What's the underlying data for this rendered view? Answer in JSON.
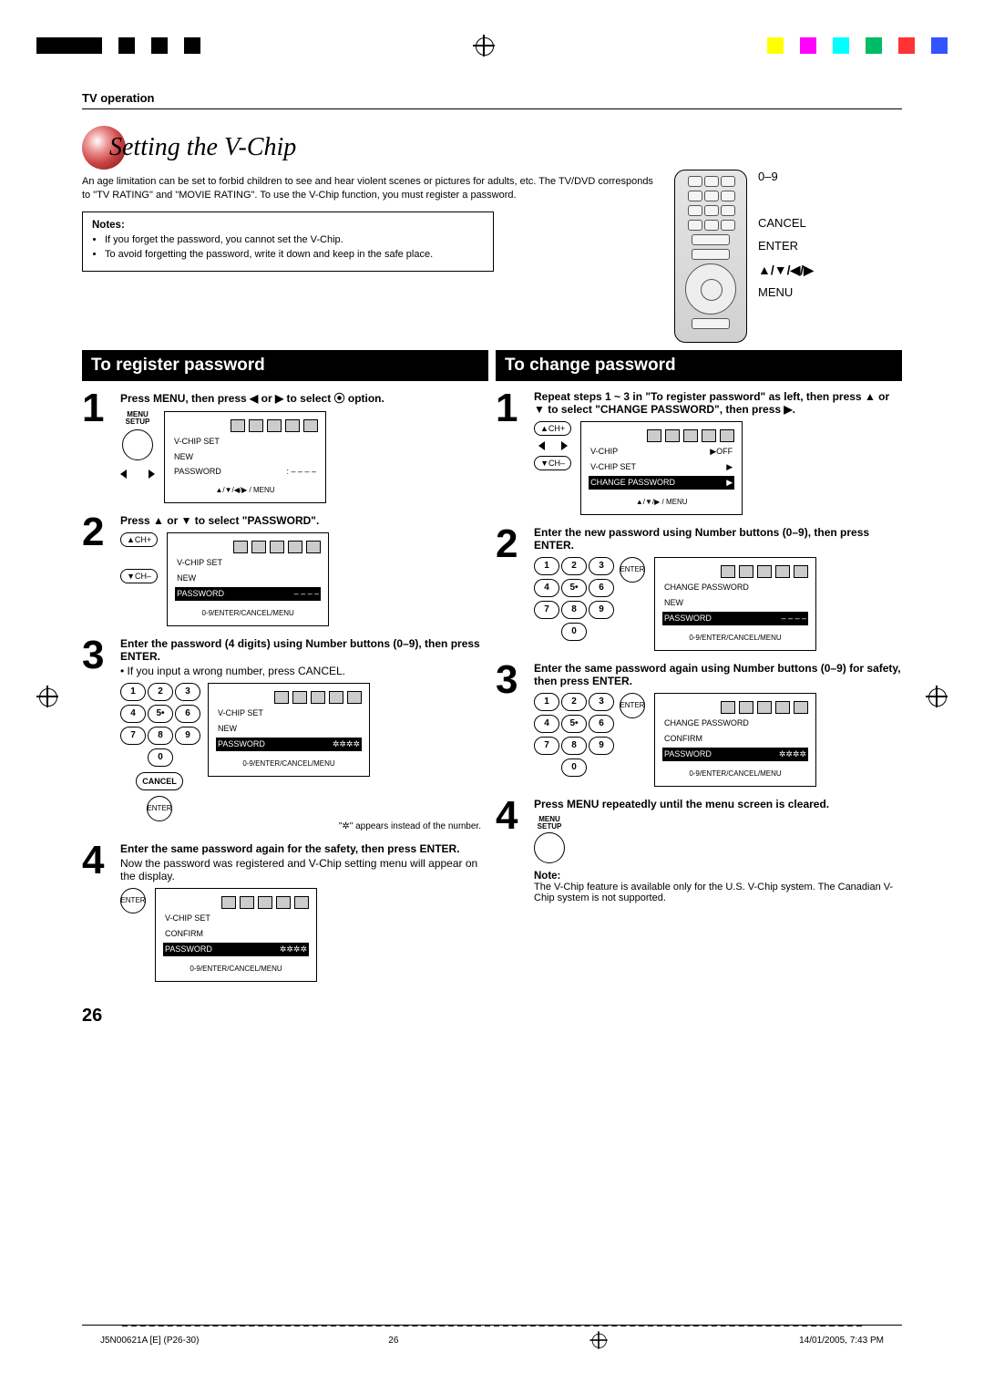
{
  "header": {
    "section": "TV operation",
    "title": "Setting the V-Chip",
    "intro": "An age limitation can be set to forbid children to see and hear violent scenes or pictures for adults, etc. The TV/DVD corresponds to \"TV RATING\" and \"MOVIE RATING\". To use the V-Chip function, you must register a password."
  },
  "notes": {
    "heading": "Notes:",
    "items": [
      "If you forget the password, you cannot set the V-Chip.",
      "To avoid forgetting the password, write it down and keep in the safe place."
    ]
  },
  "remote_labels": {
    "num": "0–9",
    "cancel": "CANCEL",
    "enter": "ENTER",
    "arrows": "▲/▼/◀/▶",
    "menu": "MENU"
  },
  "left": {
    "heading": "To register password",
    "s1": "Press MENU, then press ◀ or ▶ to select ⦿ option.",
    "s1_menu_label": "MENU\nSETUP",
    "osd1": {
      "l1": "V-CHIP  SET",
      "l2": "NEW",
      "l3": "PASSWORD",
      "l3v": ": – – – –",
      "foot": "▲/▼/◀/▶ / MENU"
    },
    "s2": "Press ▲ or ▼ to select \"PASSWORD\".",
    "osd2": {
      "l1": "V-CHIP  SET",
      "l2": "NEW",
      "l3": "PASSWORD",
      "l3v": "– – – –",
      "foot": "0-9/ENTER/CANCEL/MENU"
    },
    "s3a": "Enter the password (4 digits) using Number buttons (0–9), then press ENTER.",
    "s3b": "If you input a wrong number, press CANCEL.",
    "osd3": {
      "l1": "V-CHIP  SET",
      "l2": "NEW",
      "l3": "PASSWORD",
      "l3v": "✲✲✲✲",
      "foot": "0-9/ENTER/CANCEL/MENU"
    },
    "s3_foot": "\"✲\" appears instead of the number.",
    "s4a": "Enter the same password again for the safety, then press ENTER.",
    "s4b": "Now the password was registered and V-Chip setting menu will appear on the display.",
    "osd4": {
      "l1": "V-CHIP  SET",
      "l2": "CONFIRM",
      "l3": "PASSWORD",
      "l3v": "✲✲✲✲",
      "foot": "0-9/ENTER/CANCEL/MENU"
    }
  },
  "right": {
    "heading": "To change password",
    "s1": "Repeat steps 1 ~ 3 in \"To register password\" as left, then press ▲ or ▼ to select \"CHANGE PASSWORD\", then press ▶.",
    "osd1": {
      "l1": "V-CHIP",
      "l1v": "▶OFF",
      "l2": "V-CHIP SET",
      "l2v": "▶",
      "l3": "CHANGE PASSWORD",
      "l3v": "▶",
      "foot": "▲/▼/▶ / MENU"
    },
    "s2": "Enter the new password using Number buttons (0–9), then press ENTER.",
    "osd2": {
      "l1": "CHANGE  PASSWORD",
      "l2": "NEW",
      "l3": "PASSWORD",
      "l3v": "– – – –",
      "foot": "0-9/ENTER/CANCEL/MENU"
    },
    "s3": "Enter the same password again using Number buttons (0–9) for safety, then press ENTER.",
    "osd3": {
      "l1": "CHANGE  PASSWORD",
      "l2": "CONFIRM",
      "l3": "PASSWORD",
      "l3v": "✲✲✲✲",
      "foot": "0-9/ENTER/CANCEL/MENU"
    },
    "s4": "Press MENU repeatedly until the menu screen is cleared.",
    "note_h": "Note:",
    "note_b": "The V-Chip feature is available only for the U.S. V-Chip system. The Canadian V-Chip system is not supported."
  },
  "page_num": "26",
  "foot": {
    "left": "J5N00621A [E] (P26-30)",
    "mid": "26",
    "right": "14/01/2005, 7:43 PM"
  },
  "btn": {
    "chup": "▲CH+",
    "chdn": "▼CH–",
    "cancel": "CANCEL",
    "enter": "ENTER"
  }
}
